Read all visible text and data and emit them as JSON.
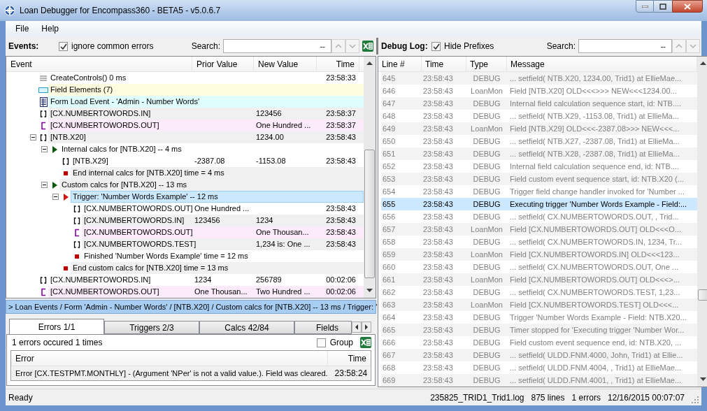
{
  "window": {
    "title": "Loan Debugger for Encompass360 - BETA5 - v5.0.6.7"
  },
  "menu": [
    "File",
    "Help"
  ],
  "events_toolbar": {
    "label": "Events:",
    "checkbox": {
      "label": "ignore common errors",
      "checked": true
    },
    "search_label": "Search:",
    "match_count": "--"
  },
  "log_toolbar": {
    "label": "Debug Log:",
    "checkbox": {
      "label": "Hide Prefixes",
      "checked": true
    },
    "search_label": "Search:",
    "match_count": "--"
  },
  "events": {
    "columns": [
      "Event",
      "Prior Value",
      "New Value",
      "Time"
    ],
    "rows": [
      {
        "kind": "method",
        "text": "CreateControls() 0 ms",
        "time": "23:58:33",
        "selected": false
      },
      {
        "kind": "elements",
        "text": "Field Elements (7)",
        "color": "#fffbe1",
        "selected": false
      },
      {
        "kind": "form",
        "text": "Form Load Event - 'Admin - Number Words'",
        "color": "#e0fdfd",
        "selected": false
      },
      {
        "kind": "field",
        "text": "[CX.NUMBERTOWORDS.IN]",
        "new": "123456",
        "time": "23:58:37",
        "color": "#f0f0f0",
        "selected": false
      },
      {
        "kind": "calc_field",
        "text": "[CX.NUMBERTOWORDS.OUT]",
        "new": "One Hundred ...",
        "time": "23:58:37",
        "color": "#fbebfb",
        "selected": false
      },
      {
        "kind": "field",
        "text": "[NTB.X20]",
        "new": "1234.00",
        "time": "23:58:43",
        "color": "#f0f0f0",
        "selected": false,
        "expanded": true,
        "children": [
          {
            "kind": "calcs",
            "text": "Internal calcs for [NTB.X20] -- 4 ms",
            "selected": false,
            "expanded": true,
            "children": [
              {
                "kind": "field",
                "text": "[NTB.X29]",
                "prior": "-2387.08",
                "new": "-1153.08",
                "time": "23:58:43",
                "selected": false
              },
              {
                "kind": "end",
                "text": "End internal calcs for [NTB.X20] time = 4 ms",
                "color": "#f0f0f0",
                "selected": false
              }
            ]
          },
          {
            "kind": "calcs",
            "text": "Custom calcs for [NTB.X20] -- 13 ms",
            "color": "#f0f0f0",
            "selected": false,
            "expanded": true,
            "children": [
              {
                "kind": "trigger",
                "text": "Trigger: 'Number Words Example' -- 12 ms",
                "selected": true,
                "expanded": true,
                "children": [
                  {
                    "kind": "field",
                    "text": "[CX.NUMBERTOWORDS.OUT]",
                    "prior": "One Hundred ...",
                    "time": "23:58:43",
                    "selected": false
                  },
                  {
                    "kind": "field",
                    "text": "[CX.NUMBERTOWORDS.IN]",
                    "prior": "123456",
                    "new": "1234",
                    "time": "23:58:43",
                    "color": "#f0f0f0",
                    "selected": false
                  },
                  {
                    "kind": "calc_field",
                    "text": "[CX.NUMBERTOWORDS.OUT]",
                    "new": "One Thousan...",
                    "time": "23:58:43",
                    "color": "#fbebfb",
                    "selected": false
                  },
                  {
                    "kind": "field",
                    "text": "[CX.NUMBERTOWORDS.TEST]",
                    "new": "1,234 is: One ...",
                    "time": "23:58:43",
                    "color": "#f0f0f0",
                    "selected": false
                  },
                  {
                    "kind": "end",
                    "text": "Finished 'Number Words Example' time = 12 ms",
                    "selected": false
                  }
                ]
              },
              {
                "kind": "end",
                "text": "End custom calcs for [NTB.X20] time = 13 ms",
                "color": "#f0f0f0",
                "selected": false
              }
            ]
          }
        ]
      },
      {
        "kind": "field",
        "text": "[CX.NUMBERTOWORDS.IN]",
        "prior": "1234",
        "new": "256789",
        "time": "00:02:06",
        "selected": false
      },
      {
        "kind": "calc_field",
        "text": "[CX.NUMBERTOWORDS.OUT]",
        "prior": "One Thousan...",
        "new": "Two Hundred ...",
        "time": "00:02:06",
        "color": "#fbebfb",
        "selected": false
      }
    ]
  },
  "breadcrumb": "> Loan Events / Form 'Admin - Number Words' / [NTB.X20] / Custom calcs for [NTB.X20] -- 13 ms / Trigger: '",
  "tabs": [
    {
      "label": "Errors 1/1",
      "selected": true
    },
    {
      "label": "Triggers 2/3",
      "selected": false
    },
    {
      "label": "Calcs 42/84",
      "selected": false
    },
    {
      "label": "Fields",
      "selected": false
    }
  ],
  "errors": {
    "summary": "1 errors occured 1 times",
    "group": {
      "label": "Group",
      "checked": false
    },
    "columns": [
      "Error",
      "Time"
    ],
    "rows": [
      {
        "error": "Error [CX.TESTPMT.MONTHLY] - (Argument 'NPer' is not a valid value.). Field was cleared.",
        "time": "23:58:24"
      }
    ]
  },
  "log": {
    "columns": [
      "Line #",
      "Time",
      "Type",
      "Message"
    ],
    "rows": [
      {
        "line": "645",
        "time": "23:58:43",
        "type": "DEBUG",
        "message": "... setfield( NTB.X20, 1234.00, Trid1)  at EllieMae...",
        "selected": false
      },
      {
        "line": "646",
        "time": "23:58:43",
        "type": "LoanMon",
        "message": "Field [NTB.X20]  OLD<<<>>>  NEW<<<1234.00...",
        "selected": false
      },
      {
        "line": "647",
        "time": "23:58:43",
        "type": "DEBUG",
        "message": "Internal field calculation sequence start, id: NTB....",
        "selected": false
      },
      {
        "line": "648",
        "time": "23:58:43",
        "type": "DEBUG",
        "message": "... setfield( NTB.X29, -1153.08, Trid1)  at EllieMa...",
        "selected": false
      },
      {
        "line": "649",
        "time": "23:58:43",
        "type": "LoanMon",
        "message": "Field [NTB.X29]  OLD<<<-2387.08>>>  NEW<<<...",
        "selected": false
      },
      {
        "line": "650",
        "time": "23:58:43",
        "type": "DEBUG",
        "message": "... setfield( NTB.X27, -2387.08, Trid1)  at EllieMa...",
        "selected": false
      },
      {
        "line": "651",
        "time": "23:58:43",
        "type": "DEBUG",
        "message": "... setfield( NTB.X28, -2387.08, Trid1)  at EllieMa...",
        "selected": false
      },
      {
        "line": "652",
        "time": "23:58:43",
        "type": "DEBUG",
        "message": "Internal field calculation sequence end, id: NTB....",
        "selected": false
      },
      {
        "line": "653",
        "time": "23:58:43",
        "type": "DEBUG",
        "message": "Field custom event sequence start, id: NTB.X20 (...",
        "selected": false
      },
      {
        "line": "654",
        "time": "23:58:43",
        "type": "DEBUG",
        "message": "Trigger field change handler invoked for 'Number ...",
        "selected": false
      },
      {
        "line": "655",
        "time": "23:58:43",
        "type": "DEBUG",
        "message": "Executing trigger 'Number Words Example - Field:...",
        "selected": true
      },
      {
        "line": "656",
        "time": "23:58:43",
        "type": "DEBUG",
        "message": "... setfield( CX.NUMBERTOWORDS.OUT, , Trid...",
        "selected": false
      },
      {
        "line": "657",
        "time": "23:58:43",
        "type": "LoanMon",
        "message": "Field [CX.NUMBERTOWORDS.OUT]  OLD<<<O...",
        "selected": false
      },
      {
        "line": "658",
        "time": "23:58:43",
        "type": "DEBUG",
        "message": "... setfield( CX.NUMBERTOWORDS.IN, 1234, Tr...",
        "selected": false
      },
      {
        "line": "659",
        "time": "23:58:43",
        "type": "LoanMon",
        "message": "Field [CX.NUMBERTOWORDS.IN]  OLD<<<123...",
        "selected": false
      },
      {
        "line": "660",
        "time": "23:58:43",
        "type": "DEBUG",
        "message": "... setfield( CX.NUMBERTOWORDS.OUT, One ...",
        "selected": false
      },
      {
        "line": "661",
        "time": "23:58:43",
        "type": "LoanMon",
        "message": "Field [CX.NUMBERTOWORDS.OUT]  OLD<<<>...",
        "selected": false
      },
      {
        "line": "662",
        "time": "23:58:43",
        "type": "DEBUG",
        "message": "... setfield( CX.NUMBERTOWORDS.TEST, 1,23...",
        "selected": false
      },
      {
        "line": "663",
        "time": "23:58:43",
        "type": "LoanMon",
        "message": "Field [CX.NUMBERTOWORDS.TEST]  OLD<<<...",
        "selected": false
      },
      {
        "line": "664",
        "time": "23:58:43",
        "type": "DEBUG",
        "message": "Trigger 'Number Words Example - Field: NTB.X20...",
        "selected": false
      },
      {
        "line": "665",
        "time": "23:58:43",
        "type": "DEBUG",
        "message": "Timer stopped for 'Executing trigger 'Number Wor...",
        "selected": false
      },
      {
        "line": "666",
        "time": "23:58:43",
        "type": "DEBUG",
        "message": "Field custom event sequence end, id: NTB.X20, ...",
        "selected": false
      },
      {
        "line": "667",
        "time": "23:58:43",
        "type": "DEBUG",
        "message": "... setfield( ULDD.FNM.4000, John, Trid1)  at Ellie...",
        "selected": false
      },
      {
        "line": "668",
        "time": "23:58:43",
        "type": "DEBUG",
        "message": "... setfield( ULDD.FNM.4004, , Trid1)  at EllieMae...",
        "selected": false
      },
      {
        "line": "669",
        "time": "23:58:43",
        "type": "DEBUG",
        "message": "... setfield( ULDD.FNM.4001, , Trid1)  at EllieMae...",
        "selected": false
      }
    ]
  },
  "status_bar": {
    "state": "Ready",
    "file": "235825_TRID1_Trid1.log",
    "lines": "875 lines",
    "errors": "1 errors",
    "timestamp": "12/16/2015 00:07:07"
  }
}
